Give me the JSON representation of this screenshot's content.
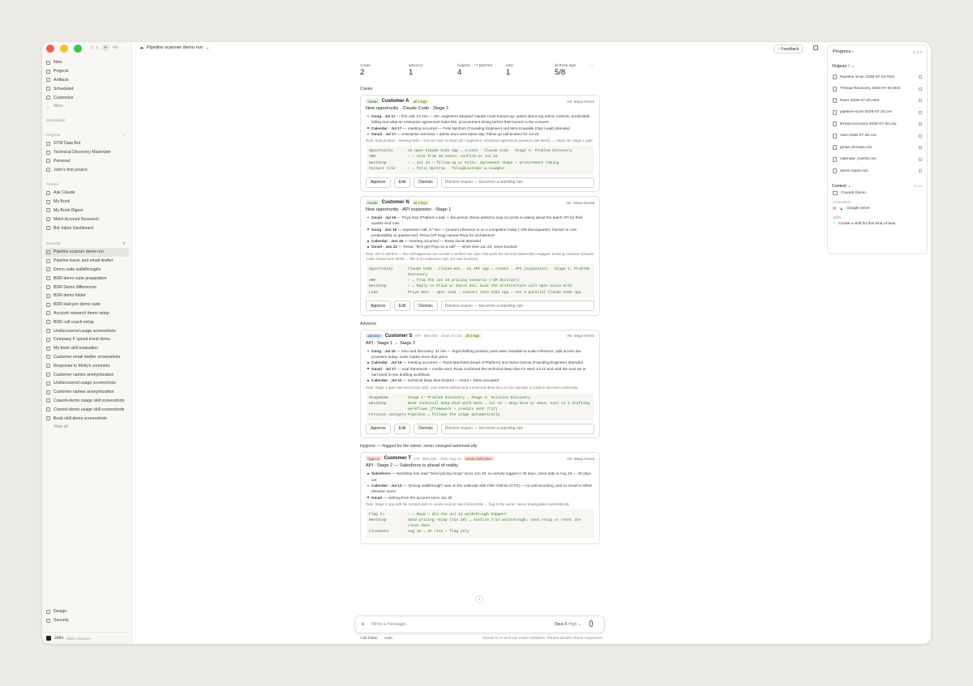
{
  "window": {
    "title": "Pipeline scanner demo run"
  },
  "topbar": {
    "feedback_label": "Feedback"
  },
  "sidebar": {
    "nav": [
      {
        "label": "New"
      },
      {
        "label": "Projects"
      },
      {
        "label": "Artifacts"
      },
      {
        "label": "Scheduled"
      },
      {
        "label": "Customize"
      },
      {
        "label": "More"
      }
    ],
    "scheduled_label": "Scheduled",
    "projects_label": "Projects",
    "projects": [
      "GTM Data Bot",
      "Technical Discovery Maximizer",
      "Personal",
      "John's first project"
    ],
    "pinned_label": "Pinned",
    "pinned": [
      "Ask Claude",
      "My Book",
      "My Book Digest",
      "Mitch Account Research",
      "Bdr Inbox Dashboard"
    ],
    "recents_label": "Recents",
    "recents": [
      "Pipeline scanner demo run",
      "Pipeline tracer and email drafter",
      "Demo suite walkthroughs",
      "BDR demo suite preparation",
      "BDR Demo differences",
      "BDR demo folder",
      "BDR Halcyon demo suite",
      "Account research demo setup",
      "BDR call coach setup",
      "Undiscovered usage screenshots",
      "Company F spend trend demo",
      "My-book skill evaluation",
      "Customer email drafter screenshots",
      "Response to Molly's comment",
      "Customer names anonymization",
      "Undiscovered usage screenshots",
      "Customer names anonymization",
      "Cowork-demo usage skill screenshots",
      "Cowork-demo usage skill screenshots",
      "Book skill demo screenshots"
    ],
    "view_all": "View all",
    "bottom": [
      {
        "label": "Design"
      },
      {
        "label": "Security"
      }
    ],
    "user": {
      "name": "John",
      "plan": "· Black clearance"
    }
  },
  "stats": [
    {
      "label": "create",
      "value": "2"
    },
    {
      "label": "advance",
      "value": "1"
    },
    {
      "label": "hygiene · +7 batched",
      "value": "4"
    },
    {
      "label": "note",
      "value": "1"
    },
    {
      "label": "all three legs",
      "value": "5/8"
    }
  ],
  "sections": {
    "create": "Create",
    "advance": "Advance",
    "hygiene": "Hygiene — flagged for the owner, never changed automatically"
  },
  "cards": [
    {
      "tag": "create",
      "name": "Customer A",
      "legs": "all 3 legs",
      "meta": "",
      "ae": "AE: Maya Torres",
      "title": "New opportunity · Claude Code · Stage 1",
      "bullets": [
        {
          "src": "Gong · Jul 17",
          "text": " — first call, 24 min — 30+ engineers adopted Claude Code bottom-up; asked about org admin controls, predictable billing and what an enterprise agreement looks like; procurement timing before their launch is the concern"
        },
        {
          "src": "Calendar · Jul 17",
          "text": " — meeting occurred — Felix Nystrom (Founding Engineer) and Mira Kowalski (Ops Lead) attended"
        },
        {
          "src": "Gmail · Jul 17",
          "text": " — enterprise overview + admin docs sent same day; follow-up call booked for Jul 24"
        }
      ],
      "rule": "Rule: Seat product · meeting held + real use case in-hand (30+ engineers, enterprise-agreement question was theirs) → clears the Stage 1 gate.",
      "fields": [
        {
          "k": "Opportunity",
          "v": "no open Claude Code opp → create · Claude Code · Stage 1: Problem Discovery"
        },
        {
          "k": "ARR",
          "v": "— → size from 30 seats; confirm on Jul 24"
        },
        {
          "k": "NextStep",
          "v": "— → Jul 24 — follow-up w/ Felix: agreement shape + procurement timing"
        },
        {
          "k": "Contact role",
          "v": "— → Felix Nystrom · felix@customer-a.example"
        }
      ]
    },
    {
      "tag": "create",
      "name": "Customer N",
      "legs": "all 3 legs",
      "meta": "",
      "ae": "AE: Alexis Novak",
      "title": "New opportunity · API expansion · Stage 1",
      "bullets": [
        {
          "src": "Gmail · Jul 16",
          "text": " — Priya Nair (Platform Lead — the person Tessa asked to loop in) wrote in asking about the batch API for their quarter-end runs"
        },
        {
          "src": "Gong · Jun 16",
          "text": " — expansion call, 27 min — product inference is on a competitor today (~2M docs/quarter); blocker is cost predictability at quarter-end; Tessa (VP Eng) named Priya for architecture"
        },
        {
          "src": "Calendar · Jun 16",
          "text": " — meeting occurred — Tessa Duval attended"
        },
        {
          "src": "Gmail · Jun 22",
          "text": " — Tessa: \"let's get Priya on a call\" — times sent Jun 23, never booked"
        }
      ],
      "rule": "Rule: API is call-first — the call happened Jun 16 with a verified use case; this week the second stakeholder engaged. Existing customer (Claude Code, closed-won 2025) → this is an expansion opp, not new business.",
      "fields": [
        {
          "k": "Opportunity",
          "v": "Claude Code · closed-won · no API opp → create · API (expansion) · Stage 1: Problem Discovery"
        },
        {
          "k": "ARR",
          "v": "— → from the Jun 18 pricing scenario (~2M docs/qtr)"
        },
        {
          "k": "NextStep",
          "v": "— → Reply to Priya w/ batch doc; book the architecture call open since 6/23"
        },
        {
          "k": "Lead",
          "v": "Priya Nair · open lead → convert into this opp — not a parallel Claude Code opp"
        }
      ]
    },
    {
      "tag": "advance",
      "name": "Customer S",
      "legs": "all 3 legs",
      "meta": "API · $60,000 · close Oct 18",
      "ae": "AE: Maya Torres",
      "title": "API · Stage 1 → Stage 2",
      "bullets": [
        {
          "src": "Gong · Jul 16",
          "text": " — intro and discovery, 31 min — legal drafting product; post-raise mandate to scale inference; split across two providers today; evals matter more than price"
        },
        {
          "src": "Calendar · Jul 16",
          "text": " — meeting occurred — Rosa Marchetti (Head of Platform) and Dana Ostrow (Founding Engineer) attended"
        },
        {
          "src": "Gmail · Jul 17",
          "text": " — eval framework + credits sent; Rosa confirmed the technical deep-dive for Wed Jul 22 and said the eval set is narrowed to two drafting workflows"
        },
        {
          "src": "Calendar · Jul 22",
          "text": " — technical deep-dive booked — Rosa + Dana accepted"
        }
      ],
      "rule": "Rule: Stage 1 gate was met on the 16th; eval criteria defined and a technical deep-dive on the calendar is solution discovery underway.",
      "fields": [
        {
          "k": "StageName",
          "v": "Stage 1: Problem Discovery → Stage 2: Solution Discovery"
        },
        {
          "k": "NextStep",
          "v": "Book technical deep-dive with Dana → Jul 22 — deep-dive w/ Dana; eval on 2 drafting workflows (framework + credits sent 7/17)"
        },
        {
          "k": "Forecast category",
          "v": "Pipeline → follows the stage automatically"
        }
      ]
    },
    {
      "tag": "hygiene",
      "name": "Customer T",
      "legs": "needs verification",
      "meta": "API · $60,000 · close Aug 19",
      "ae": "AE: Maya Torres",
      "title": "API · Stage 2 — Salesforce is ahead of reality",
      "bullets": [
        {
          "src": "Salesforce",
          "text": " — NextStep has read \"Send pricing recap\" since Jun 20; no activity logged in 30 days; close date is Aug 19 — 30 days out"
        },
        {
          "src": "Calendar · Jul 14",
          "text": " — \"pricing walkthrough\" was on the calendar with Felix Ostrow (CTO) — no call recording, and no email in either direction since"
        },
        {
          "src": "Gmail",
          "text": " — nothing from the account since Jun 20"
        }
      ],
      "rule": "Rule: Stage 2 opp with the contact dark 3+ weeks and an owed deliverable → flag to the owner. Never downgraded automatically.",
      "fields": [
        {
          "k": "Flag to",
          "v": "— → Maya — did the Jul 14 walkthrough happen?"
        },
        {
          "k": "NextStep",
          "v": "Send pricing recap (Jun 20) → Confirm 7/14 walkthrough; send recap or reset the close date"
        },
        {
          "k": "CloseDate",
          "v": "Aug 19 → at risk — flag only"
        }
      ]
    }
  ],
  "actions": {
    "approve": "Approve",
    "edit": "Edit",
    "dismiss": "Dismiss",
    "dismiss_placeholder": "Dismiss reason — becomes a standing rule"
  },
  "composer": {
    "placeholder": "Write a message...",
    "model": "Opus 5",
    "effort": "High",
    "add_folder": "Add folder",
    "auto": "Auto",
    "disclaimer": "Claude is AI and can make mistakes. Please double-check responses."
  },
  "right_panel": {
    "progress_label": "Progress",
    "page": "5 of 5",
    "outputs_label": "Outputs",
    "outputs_count": "9",
    "files": [
      "Pipeline Scan 2026-07-20.html",
      "Thread Recovery 2026-07-20.html",
      "River 2026-07-20.html",
      "pipeline-scan-2026-07-20.csv",
      "thread-recovery-2026-07-20.csv",
      "river-2026-07-20.csv",
      "gmail_threads.csv",
      "calendar_events.csv",
      "demo-notes.md"
    ],
    "context_label": "Context",
    "folder": "Cowork Demo",
    "connectors_label": "Connectors",
    "connector": "Google Drive",
    "skills_label": "Skills",
    "skill_create": "Create a skill for this kind of task"
  },
  "colors": {
    "red": "#ee5f57",
    "yellow": "#f5be30",
    "green": "#3bc649"
  }
}
